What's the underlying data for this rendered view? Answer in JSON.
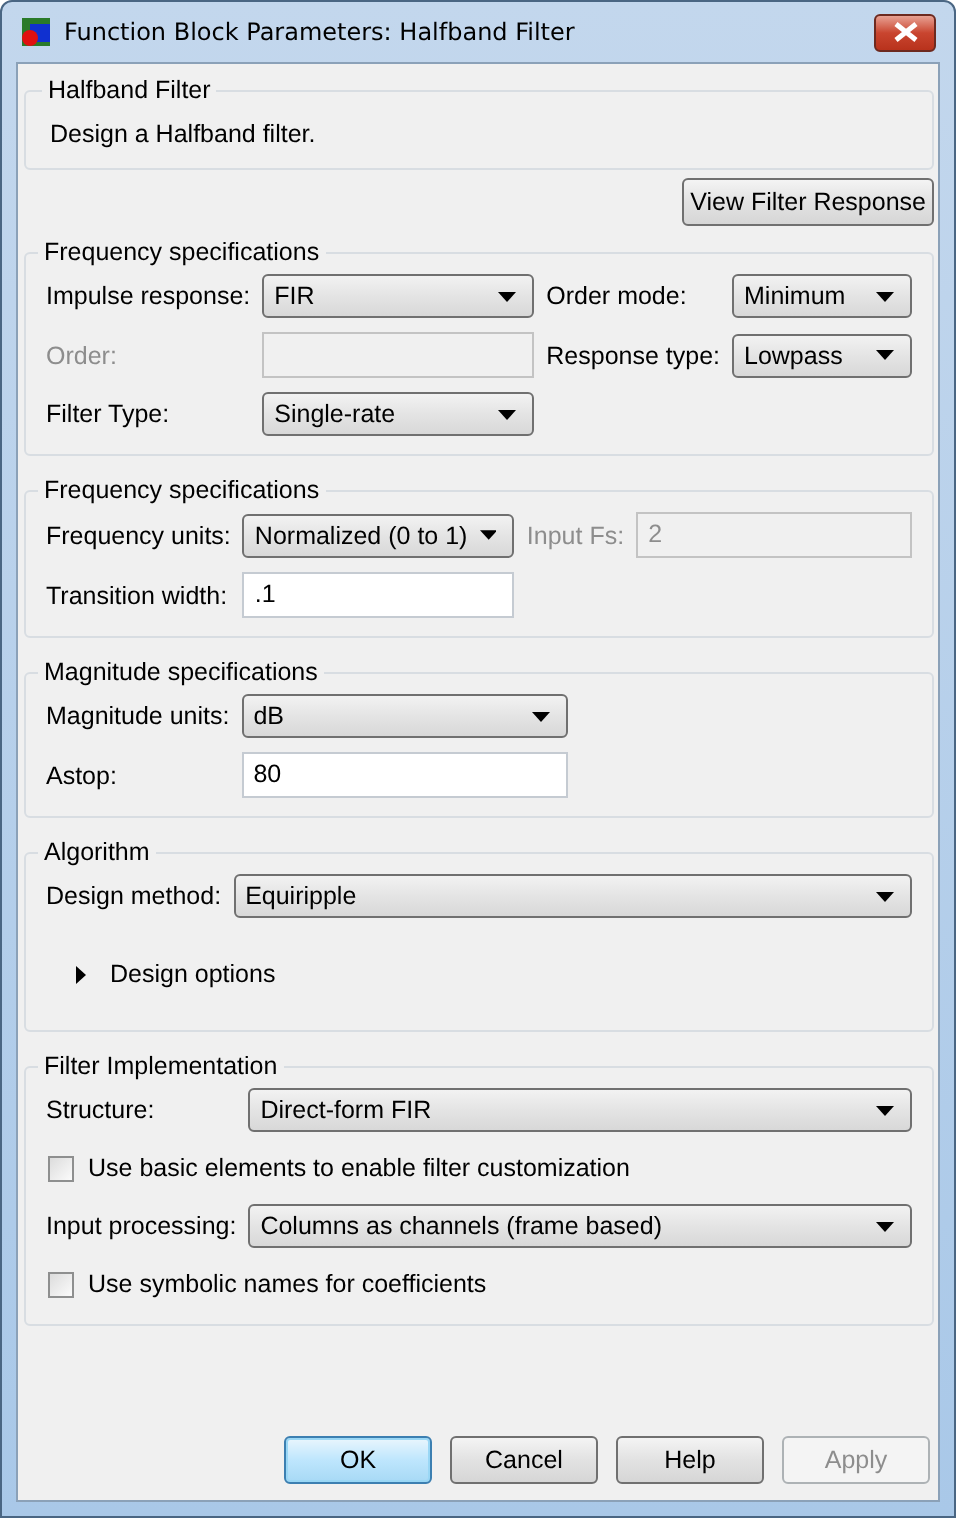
{
  "window": {
    "title": "Function Block Parameters: Halfband Filter"
  },
  "description": {
    "title": "Halfband Filter",
    "text": "Design a Halfband filter."
  },
  "view_button": "View Filter Response",
  "sections": [
    {
      "title": "Frequency specifications",
      "rows": [
        {
          "kind": "dropdown",
          "label": "Impulse response:",
          "value": "FIR"
        },
        {
          "kind": "dropdown",
          "label": "Order mode:",
          "value": "Minimum",
          "extra": {
            "label": "Order:",
            "disabled": true
          }
        },
        {
          "kind": "dropdown",
          "label": "Response type:",
          "value": "Lowpass"
        },
        {
          "kind": "dropdown",
          "label": "Filter Type:",
          "value": "Single-rate"
        }
      ]
    },
    {
      "title": "Frequency specifications",
      "rows": [
        {
          "kind": "dropdown",
          "label": "Frequency units:",
          "value": "Normalized (0 to 1)",
          "extra": {
            "label": "Input Fs:",
            "value": "2",
            "disabled": true
          }
        },
        {
          "kind": "field",
          "label": "Transition width:",
          "value": ".1"
        }
      ]
    },
    {
      "title": "Magnitude specifications",
      "rows": [
        {
          "kind": "dropdown",
          "label": "Magnitude units:",
          "value": "dB"
        },
        {
          "kind": "field",
          "label": "Astop:",
          "value": "80"
        }
      ]
    },
    {
      "title": "Algorithm",
      "rows": [
        {
          "kind": "dropdown",
          "label": "Design method:",
          "value": "Equiripple"
        },
        {
          "kind": "expander",
          "label": "Design options",
          "expanded": false
        }
      ]
    },
    {
      "title": "Filter Implementation",
      "rows": [
        {
          "kind": "dropdown",
          "label": "Structure:",
          "value": "Direct-form FIR"
        },
        {
          "kind": "checkbox",
          "label": "Use basic elements to enable filter customization",
          "checked": false
        },
        {
          "kind": "dropdown",
          "label": "Input processing:",
          "value": "Columns as channels (frame based)"
        },
        {
          "kind": "checkbox",
          "label": "Use symbolic names for coefficients",
          "checked": false
        }
      ]
    }
  ],
  "buttons": [
    {
      "label": "OK",
      "default": true,
      "disabled": false
    },
    {
      "label": "Cancel",
      "default": false,
      "disabled": false
    },
    {
      "label": "Help",
      "default": false,
      "disabled": false
    },
    {
      "label": "Apply",
      "default": false,
      "disabled": true
    }
  ]
}
